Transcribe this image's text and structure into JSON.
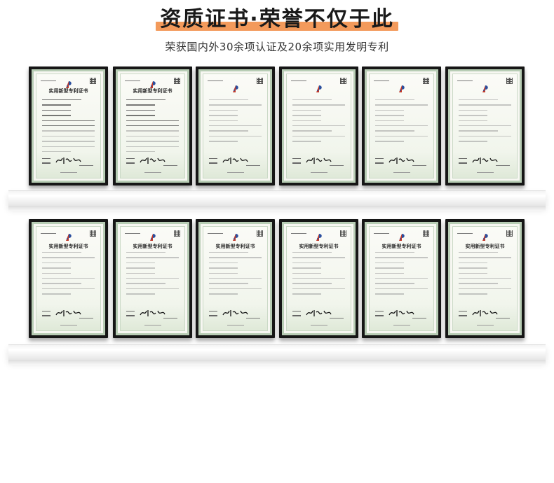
{
  "header": {
    "title": "资质证书·荣誉不仅于此",
    "subtitle": "荣获国内外30余项认证及20余项实用发明专利"
  },
  "colors": {
    "title_highlight": "#f39a5b",
    "frame": "#161616",
    "certificate_border": "#b8cdb5"
  },
  "certificates": {
    "rows": [
      {
        "items": [
          {
            "title": "实用新型专利证书",
            "style": "a"
          },
          {
            "title": "实用新型专利证书",
            "style": "a"
          },
          {
            "title": "",
            "style": "b"
          },
          {
            "title": "",
            "style": "b"
          },
          {
            "title": "",
            "style": "b"
          },
          {
            "title": "",
            "style": "b"
          }
        ]
      },
      {
        "items": [
          {
            "title": "实用新型专利证书",
            "style": "b"
          },
          {
            "title": "实用新型专利证书",
            "style": "b"
          },
          {
            "title": "实用新型专利证书",
            "style": "b"
          },
          {
            "title": "实用新型专利证书",
            "style": "b"
          },
          {
            "title": "实用新型专利证书",
            "style": "b"
          },
          {
            "title": "实用新型专利证书",
            "style": "b"
          }
        ]
      }
    ]
  }
}
